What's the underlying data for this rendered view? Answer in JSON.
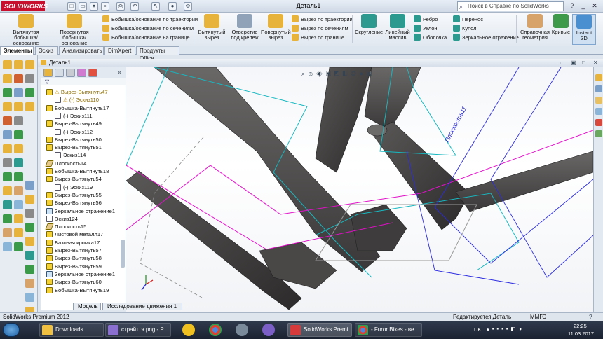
{
  "app": {
    "logo": "SOLIDWORKS",
    "document_title": "Деталь1",
    "help_search_placeholder": "Поиск в Справке по SolidWorks"
  },
  "quick_access": [
    "new-icon",
    "open-icon",
    "save-icon",
    "print-icon",
    "undo-icon",
    "select-icon",
    "rebuild-icon",
    "options-icon"
  ],
  "ribbon": {
    "big": [
      {
        "id": "extruded-boss",
        "label": "Вытянутая бобышка/основание",
        "color": "#e8b33a"
      },
      {
        "id": "revolved-boss",
        "label": "Повернутая бобышка/основание",
        "color": "#e8b33a"
      },
      {
        "id": "extruded-cut",
        "label": "Вытянутый вырез",
        "color": "#e8b33a"
      },
      {
        "id": "hole-wizard",
        "label": "Отверстие под крепеж",
        "color": "#8fa2b8"
      },
      {
        "id": "revolved-cut",
        "label": "Повернутый вырез",
        "color": "#e8b33a"
      },
      {
        "id": "fillet",
        "label": "Скругление",
        "color": "#2c9a8e"
      },
      {
        "id": "linear-pattern",
        "label": "Линейный массив",
        "color": "#2c9a8e"
      },
      {
        "id": "ref-geometry",
        "label": "Справочная геометрия",
        "color": "#d8a36a"
      },
      {
        "id": "curves",
        "label": "Кривые",
        "color": "#3c9a4a"
      },
      {
        "id": "instant3d",
        "label": "Instant 3D",
        "color": "#4a8fd0"
      }
    ],
    "small_boss": [
      {
        "label": "Бобышка/основание по траектории",
        "color": "#e8b33a"
      },
      {
        "label": "Бобышка/основание по сечениям",
        "color": "#e8b33a"
      },
      {
        "label": "Бобышка/основание на границе",
        "color": "#e8b33a"
      }
    ],
    "small_cut": [
      {
        "label": "Вырез по траектории",
        "color": "#e8b33a"
      },
      {
        "label": "Вырез по сечениям",
        "color": "#e8b33a"
      },
      {
        "label": "Вырез по границе",
        "color": "#e8b33a"
      }
    ],
    "small_features1": [
      {
        "label": "Ребро",
        "color": "#2c9a8e"
      },
      {
        "label": "Уклон",
        "color": "#2c9a8e"
      },
      {
        "label": "Оболочка",
        "color": "#2c9a8e"
      }
    ],
    "small_features2": [
      {
        "label": "Перенос",
        "color": "#2c9a8e"
      },
      {
        "label": "Купол",
        "color": "#2c9a8e"
      },
      {
        "label": "Зеркальное отражение",
        "color": "#2c9a8e"
      }
    ]
  },
  "command_tabs": [
    "Элементы",
    "Эскиз",
    "Анализировать",
    "DimXpert",
    "Продукты Office"
  ],
  "document_bar": {
    "title": "Деталь1"
  },
  "feature_tree": [
    {
      "label": "Вырез-Вытянуть47",
      "type": "fi",
      "warn": true,
      "indent": 0
    },
    {
      "label": "(-) Эскиз110",
      "type": "sk",
      "warn": true,
      "indent": 1
    },
    {
      "label": "Бобышка-Вытянуть17",
      "type": "fi",
      "warn": false,
      "indent": 0
    },
    {
      "label": "(-) Эскиз111",
      "type": "sk",
      "warn": false,
      "indent": 1
    },
    {
      "label": "Вырез-Вытянуть49",
      "type": "fi",
      "warn": false,
      "indent": 0
    },
    {
      "label": "(-) Эскиз112",
      "type": "sk",
      "warn": false,
      "indent": 1
    },
    {
      "label": "Вырез-Вытянуть50",
      "type": "fi",
      "warn": false,
      "indent": 0
    },
    {
      "label": "Вырез-Вытянуть51",
      "type": "fi",
      "warn": false,
      "indent": 0
    },
    {
      "label": "Эскиз114",
      "type": "sk",
      "warn": false,
      "indent": 1
    },
    {
      "label": "Плоскость14",
      "type": "pl",
      "warn": false,
      "indent": 0
    },
    {
      "label": "Бобышка-Вытянуть18",
      "type": "fi",
      "warn": false,
      "indent": 0
    },
    {
      "label": "Вырез-Вытянуть54",
      "type": "fi",
      "warn": false,
      "indent": 0
    },
    {
      "label": "(-) Эскиз119",
      "type": "sk",
      "warn": false,
      "indent": 1
    },
    {
      "label": "Вырез-Вытянуть55",
      "type": "fi",
      "warn": false,
      "indent": 0
    },
    {
      "label": "Вырез-Вытянуть56",
      "type": "fi",
      "warn": false,
      "indent": 0
    },
    {
      "label": "Зеркальное отражение1",
      "type": "mi",
      "warn": false,
      "indent": 0
    },
    {
      "label": "Эскиз124",
      "type": "sk",
      "warn": false,
      "indent": 0
    },
    {
      "label": "Плоскость15",
      "type": "pl",
      "warn": false,
      "indent": 0
    },
    {
      "label": "Листовой металл17",
      "type": "fi",
      "warn": false,
      "indent": 0
    },
    {
      "label": "Базовая кромка17",
      "type": "fi",
      "warn": false,
      "indent": 0
    },
    {
      "label": "Вырез-Вытянуть57",
      "type": "fi",
      "warn": false,
      "indent": 0
    },
    {
      "label": "Вырез-Вытянуть58",
      "type": "fi",
      "warn": false,
      "indent": 0
    },
    {
      "label": "Вырез-Вытянуть59",
      "type": "fi",
      "warn": false,
      "indent": 0
    },
    {
      "label": "Зеркальное отражение1",
      "type": "mi",
      "warn": false,
      "indent": 0
    },
    {
      "label": "Вырез-Вытянуть60",
      "type": "fi",
      "warn": false,
      "indent": 0
    },
    {
      "label": "Бобышка-Вытянуть19",
      "type": "fi",
      "warn": false,
      "indent": 0
    }
  ],
  "model_tabs": [
    "Модель",
    "Исследование движения 1"
  ],
  "viewport": {
    "plane_label": "Плоскость11"
  },
  "status": {
    "app_version": "SolidWorks Premium 2012",
    "state": "Редактируется Деталь",
    "units": "ММГС"
  },
  "taskbar": {
    "items": [
      {
        "label": "Downloads",
        "color": "#f0c040"
      },
      {
        "label": "страйття.png - P...",
        "color": "#8a6fd0"
      },
      {
        "label": "SolidWorks Premi...",
        "color": "#d63a3a"
      },
      {
        "label": "- Furor Bikes - ве...",
        "color": "#4a9a4a"
      }
    ],
    "lang": "UK",
    "time": "22:25",
    "date": "11.03.2017"
  }
}
